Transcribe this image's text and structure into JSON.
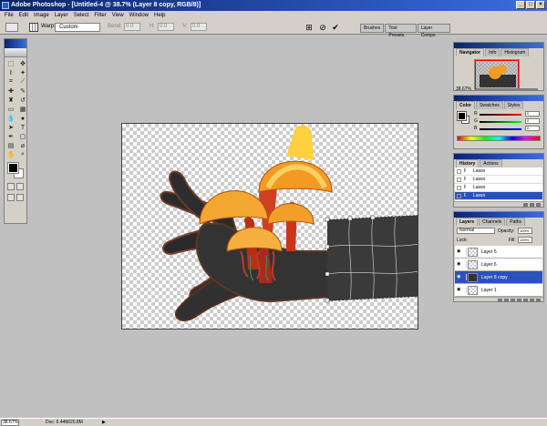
{
  "window": {
    "title": "Adobe Photoshop - [Untitled-4 @ 38.7% (Layer 8 copy, RGB/8)]"
  },
  "menu": [
    "File",
    "Edit",
    "Image",
    "Layer",
    "Select",
    "Filter",
    "View",
    "Window",
    "Help"
  ],
  "options_bar": {
    "warp_label": "Warp:",
    "warp_value": "Custom",
    "fields": [
      {
        "label": "Bend:",
        "value": "0.0"
      },
      {
        "label": "H:",
        "value": "0.0"
      },
      {
        "label": "V:",
        "value": "0.0"
      }
    ],
    "palette_well_tabs": [
      "Brushes",
      "Tool Presets",
      "Layer Comps"
    ]
  },
  "navigator": {
    "tabs": [
      "Navigator",
      "Info",
      "Histogram"
    ],
    "zoom": "38.67%"
  },
  "color": {
    "tabs": [
      "Color",
      "Swatches",
      "Styles"
    ],
    "channels": [
      {
        "label": "R",
        "value": "0",
        "track": "linear-gradient(to right,#000,#f00)"
      },
      {
        "label": "G",
        "value": "0",
        "track": "linear-gradient(to right,#000,#0f0)"
      },
      {
        "label": "B",
        "value": "0",
        "track": "linear-gradient(to right,#000,#00f)"
      }
    ]
  },
  "history": {
    "tabs": [
      "History",
      "Actions"
    ],
    "items": [
      "Lasso",
      "Lasso",
      "Lasso",
      "Lasso"
    ],
    "active_index": 3
  },
  "layers": {
    "tabs": [
      "Layers",
      "Channels",
      "Paths"
    ],
    "blend_mode": "Normal",
    "opacity_label": "Opacity:",
    "opacity": "100%",
    "fill_label": "Fill:",
    "fill": "100%",
    "lock_label": "Lock:",
    "items": [
      {
        "name": "Layer 5",
        "visible": true,
        "active": false
      },
      {
        "name": "Layer 6",
        "visible": true,
        "active": false
      },
      {
        "name": "Layer 8 copy",
        "visible": true,
        "active": true
      },
      {
        "name": "Layer 1",
        "visible": true,
        "active": false
      }
    ]
  },
  "status": {
    "zoom": "38.67%",
    "doc": "Doc: 6.44M/20.8M"
  },
  "colors": {
    "title_blue": "#0a246a",
    "selection_blue": "#2a52be",
    "chrome": "#d4d0c8",
    "workspace": "#c0c0c0"
  }
}
